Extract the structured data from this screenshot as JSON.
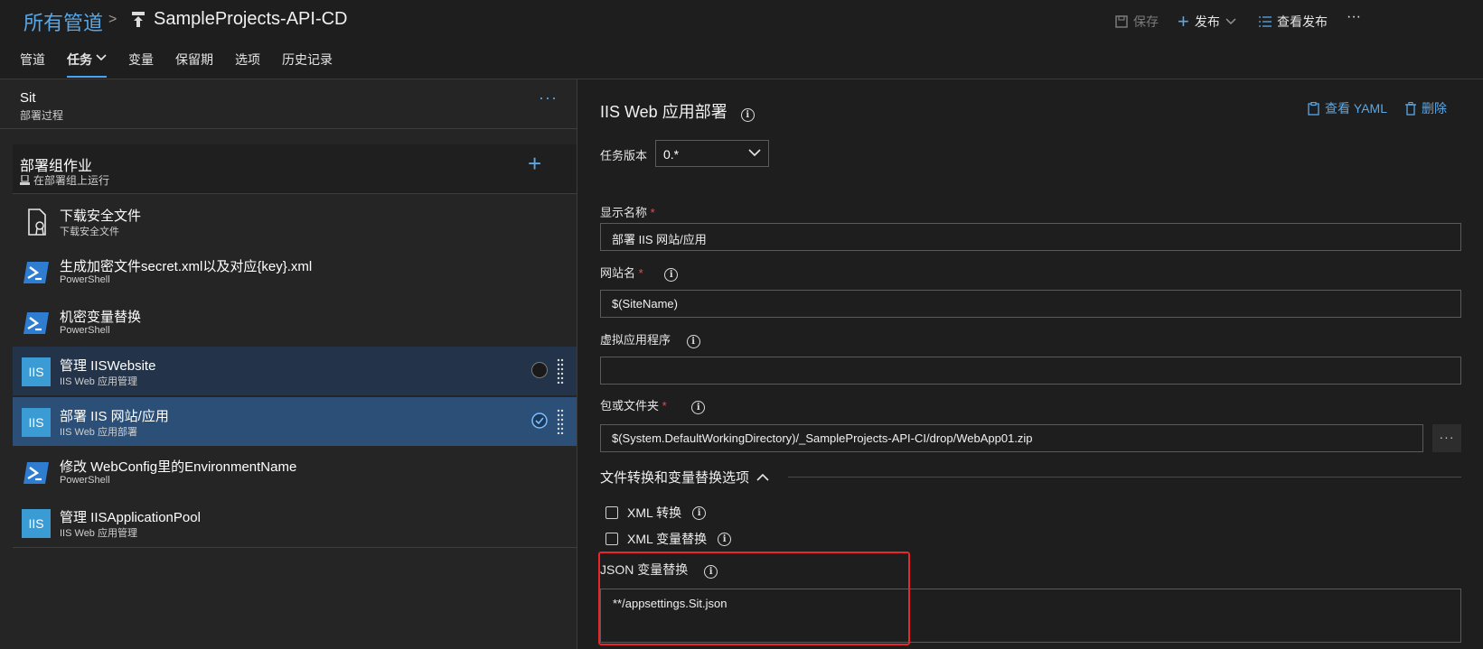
{
  "header": {
    "breadcrumb_root": "所有管道",
    "breadcrumb_sep": ">",
    "pipeline_title": "SampleProjects-API-CD",
    "save_label": "保存",
    "release_label": "发布",
    "view_releases_label": "查看发布",
    "more_label": "···"
  },
  "tabs": [
    {
      "label": "管道"
    },
    {
      "label": "任务"
    },
    {
      "label": "变量"
    },
    {
      "label": "保留期"
    },
    {
      "label": "选项"
    },
    {
      "label": "历史记录"
    }
  ],
  "stage": {
    "name": "Sit",
    "subtitle": "部署过程",
    "more": "···"
  },
  "job": {
    "title": "部署组作业",
    "subtitle": "在部署组上运行",
    "add": "+"
  },
  "tasks": [
    {
      "name": "下载安全文件",
      "sub": "下载安全文件",
      "icon": "secure-file-icon"
    },
    {
      "name": "生成加密文件secret.xml以及对应{key}.xml",
      "sub": "PowerShell",
      "icon": "powershell-icon"
    },
    {
      "name": "机密变量替换",
      "sub": "PowerShell",
      "icon": "powershell-icon"
    },
    {
      "name": "管理 IISWebsite",
      "sub": "IIS Web 应用管理",
      "icon": "iis-icon"
    },
    {
      "name": "部署 IIS 网站/应用",
      "sub": "IIS Web 应用部署",
      "icon": "iis-icon"
    },
    {
      "name": "修改 WebConfig里的EnvironmentName",
      "sub": "PowerShell",
      "icon": "powershell-icon"
    },
    {
      "name": "管理 IISApplicationPool",
      "sub": "IIS Web 应用管理",
      "icon": "iis-icon"
    }
  ],
  "iis_icon_text": "IIS",
  "detail": {
    "title": "IIS Web 应用部署",
    "view_yaml": "查看 YAML",
    "delete": "删除",
    "task_version_label": "任务版本",
    "task_version_value": "0.*",
    "display_name_label": "显示名称",
    "display_name_value": "部署 IIS 网站/应用",
    "website_name_label": "网站名",
    "website_name_value": "$(SiteName)",
    "virtual_app_label": "虚拟应用程序",
    "virtual_app_value": "",
    "package_label": "包或文件夹",
    "package_value": "$(System.DefaultWorkingDirectory)/_SampleProjects-API-CI/drop/WebApp01.zip",
    "browse": "···",
    "section_title": "文件转换和变量替换选项",
    "xml_transform_label": "XML 转换",
    "xml_var_label": "XML 变量替换",
    "json_var_label": "JSON 变量替换",
    "json_var_value": "**/appsettings.Sit.json",
    "required_mark": "*",
    "info_mark": "i"
  },
  "colors": {
    "accent": "#5aa7e6",
    "selected_row": "#2b4f76",
    "hover_row": "#23344a",
    "highlight_box": "#e8262b"
  }
}
